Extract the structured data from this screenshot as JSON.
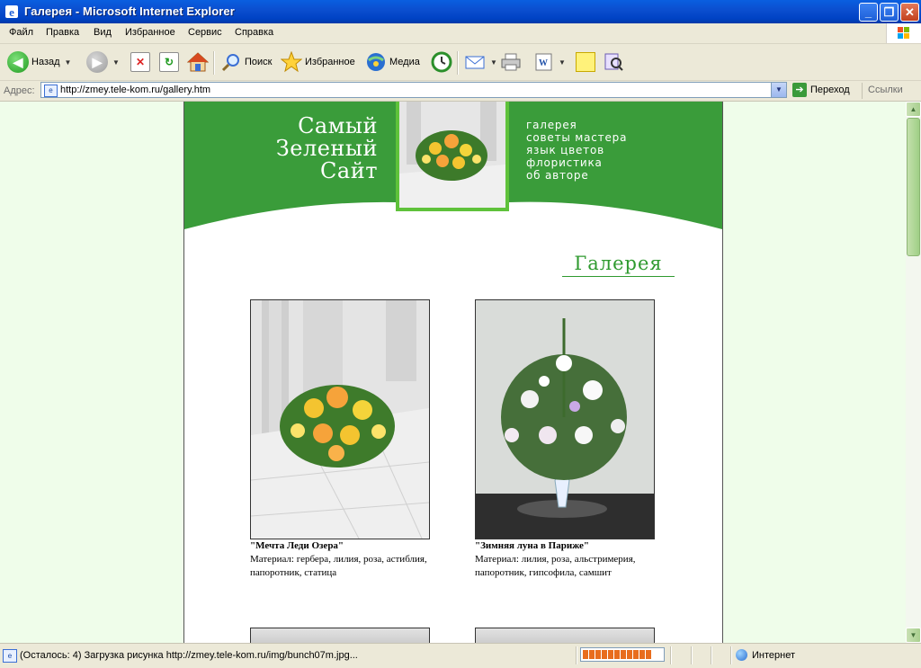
{
  "window": {
    "title": "Галерея - Microsoft Internet Explorer"
  },
  "menu": [
    "Файл",
    "Правка",
    "Вид",
    "Избранное",
    "Сервис",
    "Справка"
  ],
  "toolbar": {
    "back": "Назад",
    "search": "Поиск",
    "favorites": "Избранное",
    "media": "Медиа"
  },
  "address": {
    "label": "Адрес:",
    "url": "http://zmey.tele-kom.ru/gallery.htm",
    "go": "Переход",
    "links": "Ссылки"
  },
  "site": {
    "logo": [
      "Самый",
      "Зеленый",
      "Сайт"
    ],
    "nav": [
      "галерея",
      "советы мастера",
      "язык цветов",
      "флористика",
      "об авторе"
    ],
    "heading": "Галерея"
  },
  "gallery": [
    {
      "title": "\"Мечта Леди Озера\"",
      "desc": "Материал: гербера, лилия, роза, астиблия, папоротник, статица"
    },
    {
      "title": "\"Зимняя луна в Париже\"",
      "desc": "Материал: лилия, роза, альстримерия, папоротник, гипсофила, самшит"
    }
  ],
  "status": {
    "text": "(Осталось: 4) Загрузка рисунка http://zmey.tele-kom.ru/img/bunch07m.jpg...",
    "progress": 0.9,
    "zone": "Интернет"
  },
  "colors": {
    "site_green": "#3a9c3a",
    "page_bg": "#effdea",
    "heading_green": "#2f9a2f"
  }
}
